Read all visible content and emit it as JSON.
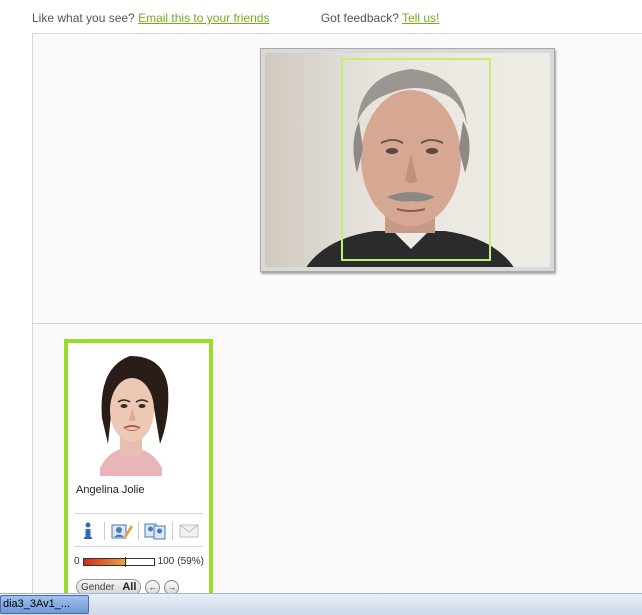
{
  "topbar": {
    "like_text": "Like what you see?",
    "email_link": "Email this to your friends",
    "feedback_text": "Got feedback?",
    "tellus_link": "Tell us!"
  },
  "match": {
    "name": "Angelina Jolie",
    "meter_min": "0",
    "meter_max": "100",
    "meter_percent_label": "(59%)",
    "meter_value": 0.59
  },
  "controls": {
    "gender_label": "Gender",
    "gender_value": "All",
    "prev_symbol": "←",
    "next_symbol": "→"
  },
  "icons": [
    "info-icon",
    "edit-person-icon",
    "compare-icon",
    "email-icon"
  ],
  "colors": {
    "accent_green": "#98dd2a",
    "link_green": "#7aab1f",
    "face_box": "#bff272"
  },
  "taskbar": {
    "task_label": "dia3_3Av1_..."
  }
}
